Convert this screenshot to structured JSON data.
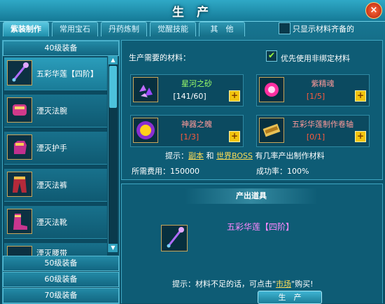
{
  "window": {
    "title": "生 产",
    "close_label": "×"
  },
  "tabs": [
    {
      "label": "紫装制作",
      "active": true
    },
    {
      "label": "常用宝石",
      "active": false
    },
    {
      "label": "丹药炼制",
      "active": false
    },
    {
      "label": "觉醒技能",
      "active": false
    },
    {
      "label": "其　他",
      "active": false
    }
  ],
  "filter": {
    "label": "只显示材料齐备的",
    "checked": false
  },
  "sidebar": {
    "levels": [
      "40级装备",
      "50级装备",
      "60级装备",
      "70级装备"
    ],
    "items": [
      {
        "label": "五彩华莲【四阶】",
        "icon": "staff-icon",
        "selected": true
      },
      {
        "label": "湮灭法腕",
        "icon": "bracer-icon",
        "selected": false
      },
      {
        "label": "湮灭护手",
        "icon": "glove-icon",
        "selected": false
      },
      {
        "label": "湮灭法裤",
        "icon": "pants-icon",
        "selected": false
      },
      {
        "label": "湮灭法靴",
        "icon": "boots-icon",
        "selected": false
      },
      {
        "label": "湮灭腰带",
        "icon": "belt-icon",
        "selected": false
      }
    ]
  },
  "materials": {
    "heading": "生产需要的材料：",
    "option_label": "优先使用非绑定材料",
    "option_checked": true,
    "items": [
      {
        "name": "星河之砂",
        "count": "[141/60]",
        "enough": true,
        "icon": "crystal-icon"
      },
      {
        "name": "紫精魂",
        "count": "[1/5]",
        "enough": false,
        "icon": "soul-orb-icon"
      },
      {
        "name": "神器之魄",
        "count": "[1/3]",
        "enough": false,
        "icon": "gold-orb-icon"
      },
      {
        "name": "五彩华莲制作卷轴",
        "count": "[0/1]",
        "enough": false,
        "icon": "scroll-icon"
      }
    ],
    "hint_prefix": "提示：",
    "hint_link1": "副本",
    "hint_mid": " 和 ",
    "hint_link2": "世界BOSS",
    "hint_suffix": " 有几率产出制作材料",
    "cost_label": "所需费用：",
    "cost_value": "150000",
    "rate_label": "成功率：",
    "rate_value": "100%"
  },
  "output": {
    "heading": "产出道具",
    "item_name": "五彩华莲【四阶】",
    "hint_prefix": "提示：材料不足的话，可点击\"",
    "hint_link": "市场",
    "hint_suffix": "\"购买!",
    "produce_button": "生　产"
  },
  "colors": {
    "enough": "#ffffff",
    "lacking": "#ff5a3c",
    "link": "#ffdd55",
    "item_name": "#ff88ff"
  }
}
